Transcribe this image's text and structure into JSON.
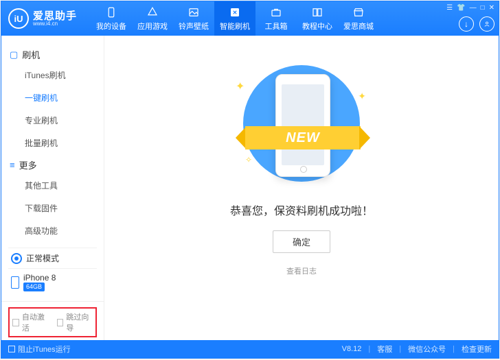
{
  "logo": {
    "mark": "iU",
    "title": "爱思助手",
    "url": "www.i4.cn"
  },
  "topnav": [
    {
      "label": "我的设备"
    },
    {
      "label": "应用游戏"
    },
    {
      "label": "铃声壁纸"
    },
    {
      "label": "智能刷机",
      "active": true
    },
    {
      "label": "工具箱"
    },
    {
      "label": "教程中心"
    },
    {
      "label": "爱思商城"
    }
  ],
  "sidebar": {
    "sections": [
      {
        "title": "刷机",
        "items": [
          {
            "label": "iTunes刷机"
          },
          {
            "label": "一键刷机",
            "active": true
          },
          {
            "label": "专业刷机"
          },
          {
            "label": "批量刷机"
          }
        ]
      },
      {
        "title": "更多",
        "items": [
          {
            "label": "其他工具"
          },
          {
            "label": "下载固件"
          },
          {
            "label": "高级功能"
          }
        ]
      }
    ],
    "mode": "正常模式",
    "device": {
      "name": "iPhone 8",
      "capacity": "64GB"
    },
    "checks": [
      {
        "label": "自动激活"
      },
      {
        "label": "跳过向导"
      }
    ]
  },
  "main": {
    "ribbon": "NEW",
    "message": "恭喜您，保资料刷机成功啦！",
    "ok": "确定",
    "viewlog": "查看日志"
  },
  "footer": {
    "block_itunes": "阻止iTunes运行",
    "version": "V8.12",
    "links": [
      "客服",
      "微信公众号",
      "检查更新"
    ]
  }
}
